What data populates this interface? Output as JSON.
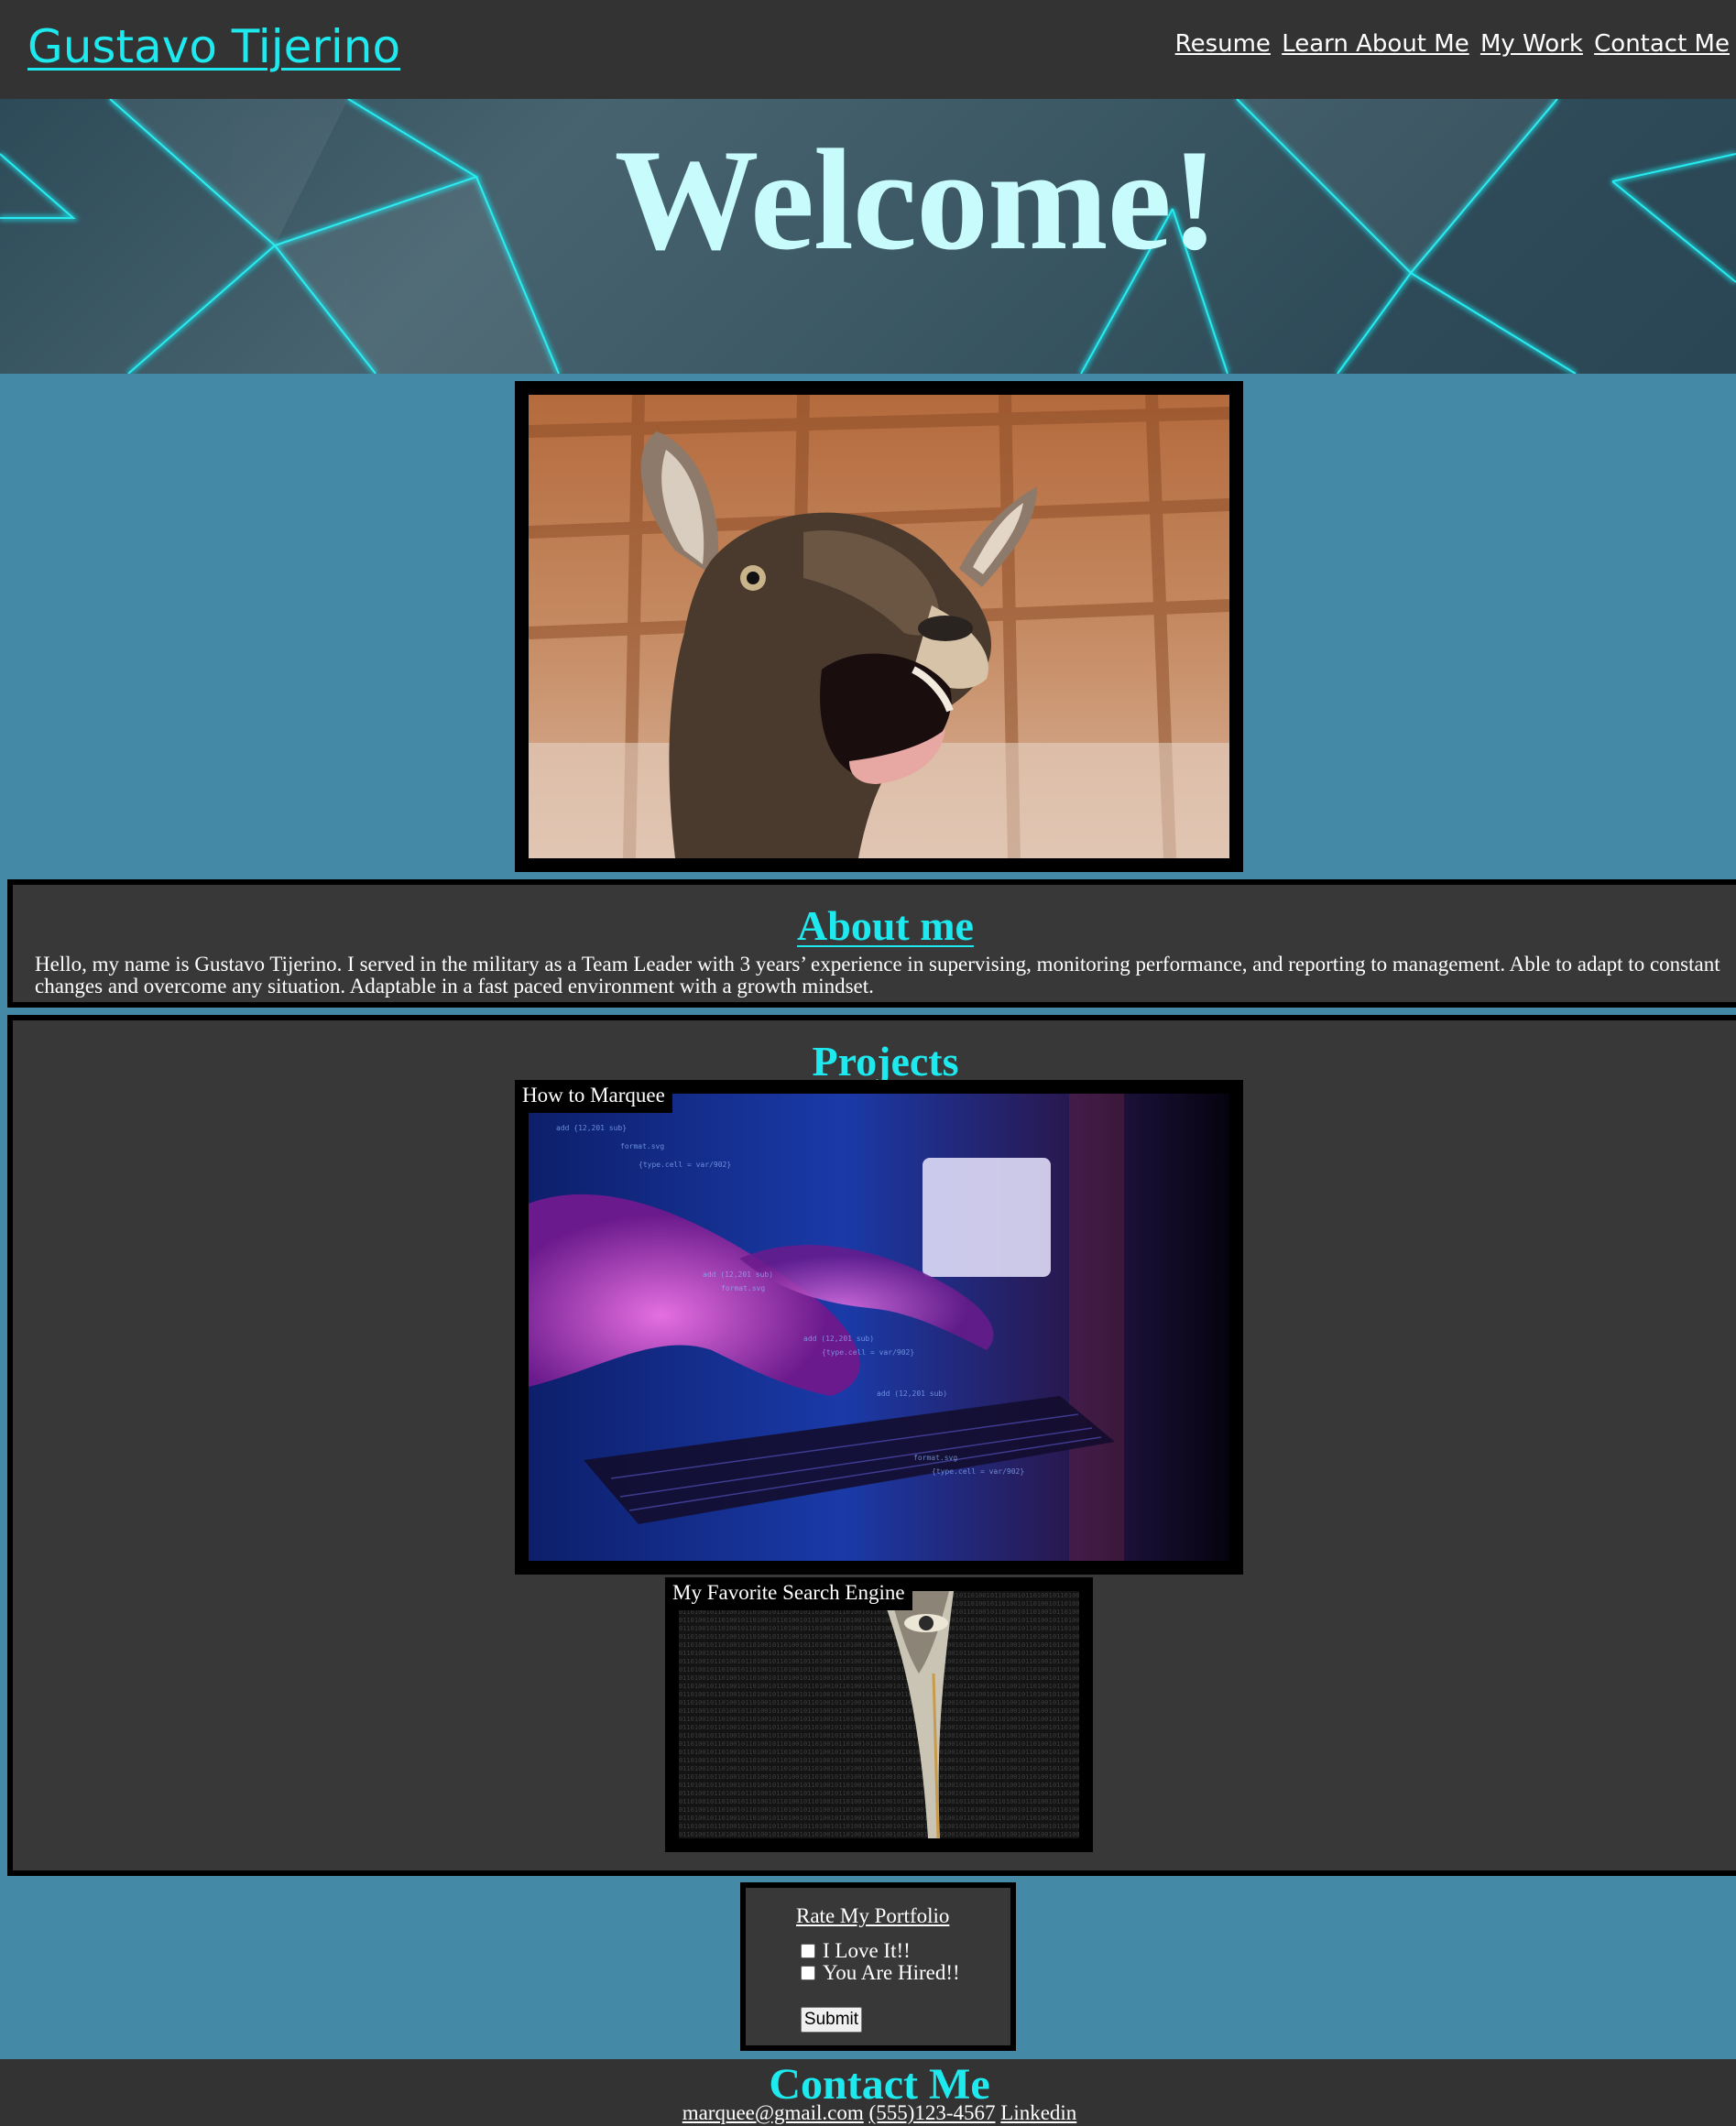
{
  "header": {
    "brand": "Gustavo Tijerino",
    "nav": [
      "Resume",
      "Learn About Me",
      "My Work",
      "Contact Me"
    ]
  },
  "hero": {
    "title": "Welcome!"
  },
  "about": {
    "heading": "About me",
    "text": "Hello, my name is Gustavo Tijerino. I served in the military as a Team Leader with 3 years’ experience in supervising, monitoring performance, and reporting to management. Able to adapt to constant changes and overcome any situation. Adaptable in a fast paced environment with a growth mindset."
  },
  "projects": {
    "heading": "Projects",
    "items": [
      {
        "caption": "How to Marquee"
      },
      {
        "caption": "My Favorite Search Engine"
      }
    ]
  },
  "rate_form": {
    "title": "Rate My Portfolio",
    "options": [
      "I Love It!!",
      "You Are Hired!!"
    ],
    "submit": "Submit"
  },
  "footer": {
    "heading": "Contact Me",
    "email": "marquee@gmail.com",
    "phone": "(555)123-4567",
    "linkedin": "Linkedin"
  },
  "colors": {
    "accent": "#1ee9ee",
    "header_bg": "#333333",
    "page_bg": "#4489a6",
    "panel_bg": "#383838"
  }
}
